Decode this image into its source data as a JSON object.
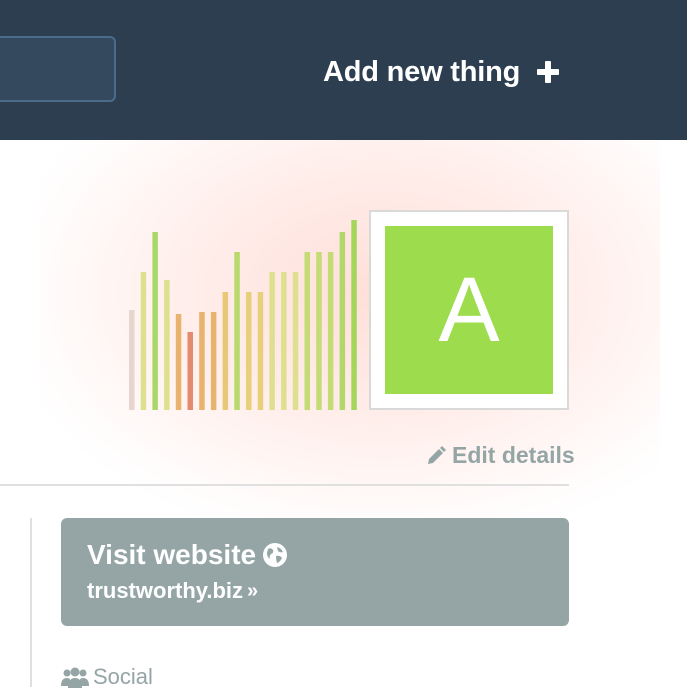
{
  "header": {
    "add_label": "Add new thing",
    "add_icon": "plus-icon",
    "search_icon": "search-box"
  },
  "profile": {
    "avatar_letter": "A",
    "avatar_color": "#9cdc4d",
    "edit_label": "Edit details",
    "edit_icon": "pencil-icon"
  },
  "chart_data": {
    "type": "bar",
    "title": "",
    "values": [
      50,
      69,
      89,
      65,
      48,
      39,
      49,
      49,
      59,
      79,
      59,
      59,
      69,
      69,
      69,
      79,
      79,
      79,
      89,
      95
    ],
    "colors": [
      "#e8d5d0",
      "#dfe08f",
      "#a9d86a",
      "#dfe08f",
      "#e8b36e",
      "#e48a6e",
      "#e8b36e",
      "#e8b36e",
      "#e8c777",
      "#b8da6c",
      "#e8cf7a",
      "#e8cf7a",
      "#dfe08f",
      "#dfe08f",
      "#dfe08f",
      "#c4dc76",
      "#c4dc76",
      "#c4dc76",
      "#b2d869",
      "#a5d65c"
    ],
    "ylim": [
      0,
      100
    ]
  },
  "links": {
    "visit_title": "Visit website",
    "visit_icon": "globe-icon",
    "url": "trustworthy.biz",
    "url_suffix": "»",
    "social_label": "Social",
    "social_icon": "people-icon"
  },
  "colors": {
    "header_bg": "#2c3e50",
    "card_bg": "#95a5a6",
    "muted_text": "#95a5a6"
  }
}
